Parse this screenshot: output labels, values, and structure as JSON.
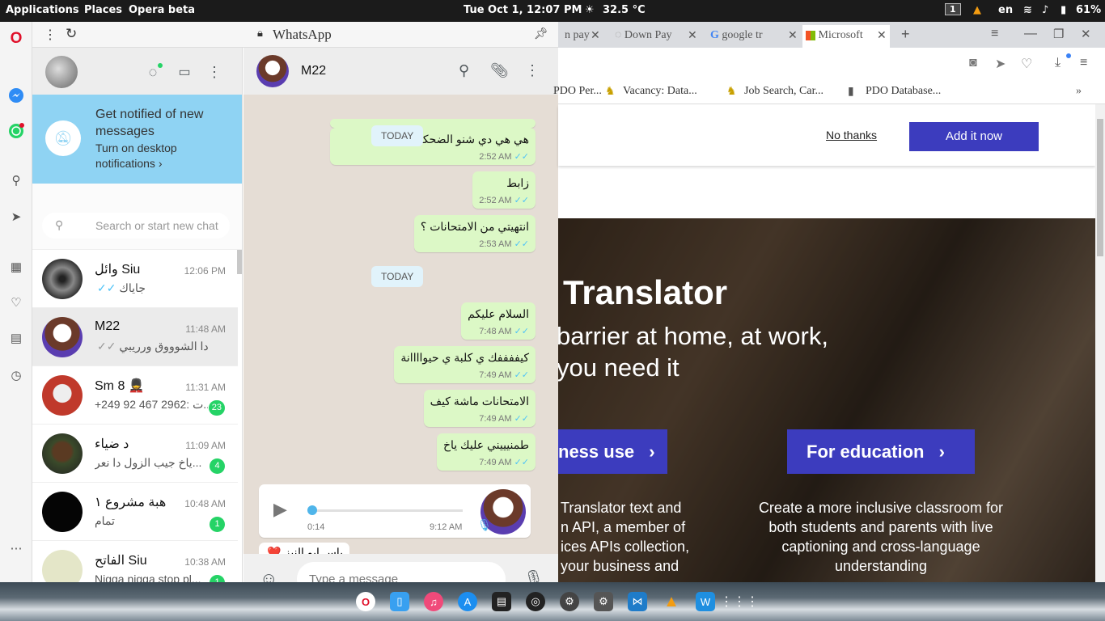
{
  "topbar": {
    "applications": "Applications",
    "places": "Places",
    "app": "Opera beta",
    "datetime": "Tue Oct  1, 12:07 PM",
    "weather": "32.5 °C",
    "workspace": "1",
    "lang": "en",
    "battery": "61%"
  },
  "whatsapp": {
    "title": "WhatsApp",
    "notification": {
      "title": "Get notified of new messages",
      "action": "Turn on desktop notifications ›"
    },
    "search_placeholder": "Search or start new chat",
    "chats": [
      {
        "name": "وائل Siu",
        "time": "12:06 PM",
        "preview": "جاياك",
        "ticks": "✓✓",
        "badge": ""
      },
      {
        "name": "M22",
        "time": "11:48 AM",
        "preview": "دا الشوووق ورريبي",
        "ticks": "✓✓",
        "badge": ""
      },
      {
        "name": "Sm 8 💂",
        "time": "11:31 AM",
        "preview": "+249 92 467 2962: ت...",
        "ticks": "",
        "badge": "23"
      },
      {
        "name": "د ضياء",
        "time": "11:09 AM",
        "preview": "ياخ جيب الزول دا نعر...",
        "ticks": "",
        "badge": "4"
      },
      {
        "name": "هبة مشروع ١",
        "time": "10:48 AM",
        "preview": "تمام",
        "ticks": "",
        "badge": "1"
      },
      {
        "name": "الفاتح Siu",
        "time": "10:38 AM",
        "preview": "Nigga nigga stop pl...",
        "ticks": "",
        "badge": "1"
      }
    ],
    "conversation": {
      "contact": "M22",
      "messages": [
        {
          "text": "هي هي دي شنو الضحكة ...زية دي",
          "time": "2:52 AM"
        },
        {
          "text": "زابط",
          "time": "2:52 AM"
        },
        {
          "text": "انتهيتي من الامتحانات ؟",
          "time": "2:53 AM"
        },
        {
          "text": "السلام عليكم",
          "time": "7:48 AM"
        },
        {
          "text": "كيففففك ي كلبة ي حيواااانة",
          "time": "7:49 AM"
        },
        {
          "text": "الامتحانات ماشة كيف",
          "time": "7:49 AM"
        },
        {
          "text": "طمنيييني عليك ياخ",
          "time": "7:49 AM"
        }
      ],
      "day_label_top": "TODAY",
      "day_label": "TODAY",
      "voice": {
        "duration": "0:14",
        "time": "9:12 AM"
      },
      "partial_msg": "ياس ابو النبز ❤️",
      "compose_placeholder": "Type a message"
    }
  },
  "browser": {
    "tabs": [
      "n pay",
      "Down Pay",
      "google tr",
      "Microsoft"
    ],
    "bookmarks": [
      "PDO Per...",
      "Vacancy: Data...",
      "Job Search, Car...",
      "PDO Database..."
    ],
    "banner": {
      "no_thanks": "No thanks",
      "add_now": "Add it now"
    },
    "hero": {
      "title": "Translator",
      "subtitle_1": "barrier at home, at work,",
      "subtitle_2": "you need it",
      "btn_business": "ness use",
      "btn_education": "For education",
      "col1": [
        "Translator text and",
        "n API, a member of",
        "ices APIs collection,",
        "your business and"
      ],
      "col2": "Create a more inclusive classroom for both students and parents with live captioning and cross-language understanding"
    }
  },
  "colors": {
    "accent": "#25d366",
    "notify": "#8fd3f3",
    "ms_button": "#3c3cbe",
    "bubble": "#dcf8c6"
  }
}
